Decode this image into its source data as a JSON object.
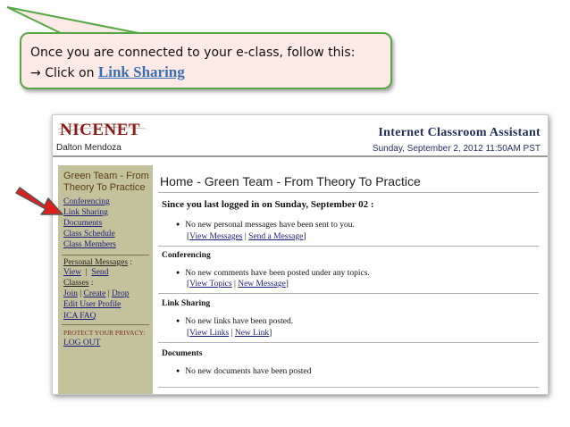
{
  "callout": {
    "line1": "Once you are connected to your e-class, follow this:",
    "arrow_glyph": "→",
    "line2_prefix": "Click on",
    "line2_link": "Link Sharing"
  },
  "header": {
    "logo": "NICENET",
    "user": "Dalton Mendoza",
    "app_title": "Internet Classroom Assistant",
    "datetime": "Sunday, September 2, 2012 11:50AM PST"
  },
  "sidebar": {
    "title": "Green Team - From Theory To Practice",
    "items": {
      "conferencing": "Conferencing",
      "link_sharing": "Link Sharing",
      "documents": "Documents",
      "class_schedule": "Class Schedule",
      "class_members": "Class Members"
    },
    "personal_messages": "Personal Messages",
    "view": "View",
    "send": "Send",
    "classes": "Classes",
    "join": "Join",
    "create": "Create",
    "drop": "Drop",
    "edit_profile": "Edit User Profile",
    "ica_faq": "ICA FAQ",
    "privacy": "PROTECT YOUR PRIVACY:",
    "logout": "LOG OUT"
  },
  "main": {
    "title": "Home - Green Team - From Theory To Practice",
    "since": "Since you last logged in on Sunday, September 02 :",
    "messages": {
      "text": "No new personal messages have been sent to you.",
      "link1": "View Messages",
      "link2": "Send a Message"
    },
    "conferencing": {
      "heading": "Conferencing",
      "text": "No new comments have been posted under any topics.",
      "link1": "View Topics",
      "link2": "New Message"
    },
    "link_sharing": {
      "heading": "Link Sharing",
      "text": "No new links have been posted.",
      "link1": "View Links",
      "link2": "New Link"
    },
    "documents": {
      "heading": "Documents",
      "text": "No new documents have been posted"
    }
  },
  "colors": {
    "callout_fill": "#fde9e5",
    "callout_border": "#58a845",
    "sidebar_bg": "#c4c29d",
    "arrow_red": "#e0201c"
  }
}
